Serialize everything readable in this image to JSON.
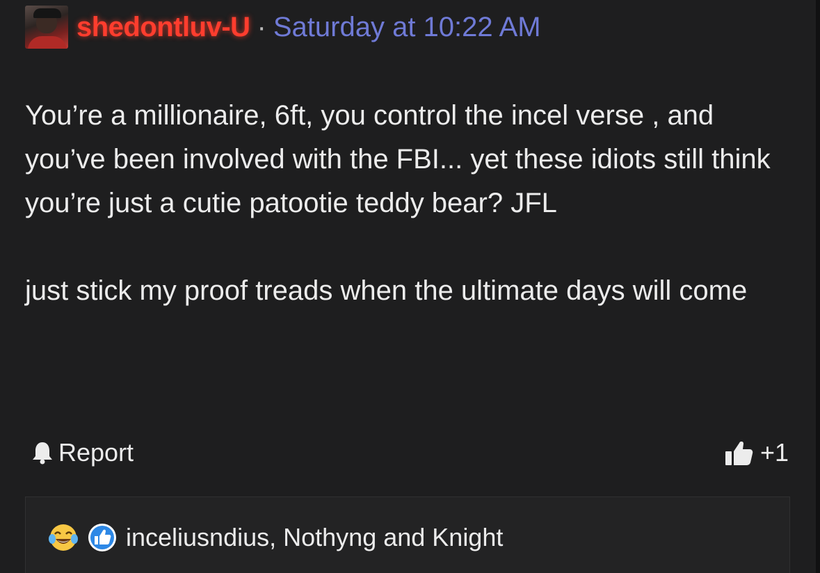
{
  "post": {
    "username": "shedontluv-U",
    "separator": "·",
    "timestamp": "Saturday at 10:22 AM",
    "paragraphs": [
      "You’re a millionaire, 6ft, you control the incel verse , and you’ve been involved with the FBI... yet these idiots still think you’re just a cutie patootie teddy bear? JFL",
      "just stick my proof treads when the ultimate days will come"
    ]
  },
  "actions": {
    "report_label": "Report",
    "vote_count": "+1"
  },
  "reactions": {
    "users": "inceliusndius, Nothyng and Knight"
  },
  "icons": {
    "report": "bell-icon",
    "vote": "thumbs-up-icon",
    "reaction_1": "crying-laughing-emoji",
    "reaction_2": "like-badge-icon"
  },
  "colors": {
    "background": "#1e1e1f",
    "username": "#ff3d2e",
    "timestamp": "#6f7ad6",
    "text": "#ececec",
    "like_badge": "#2d88e6"
  }
}
